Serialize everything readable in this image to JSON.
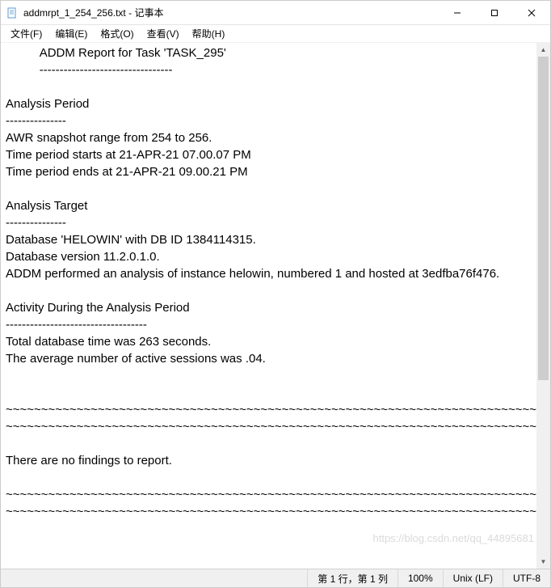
{
  "window": {
    "filename": "addmrpt_1_254_256.txt",
    "app_name": "记事本"
  },
  "menu": {
    "file": "文件(F)",
    "edit": "编辑(E)",
    "format": "格式(O)",
    "view": "查看(V)",
    "help": "帮助(H)"
  },
  "document": {
    "body": "          ADDM Report for Task 'TASK_295'\n          ---------------------------------\n\nAnalysis Period\n---------------\nAWR snapshot range from 254 to 256.\nTime period starts at 21-APR-21 07.00.07 PM\nTime period ends at 21-APR-21 09.00.21 PM\n\nAnalysis Target\n---------------\nDatabase 'HELOWIN' with DB ID 1384114315.\nDatabase version 11.2.0.1.0.\nADDM performed an analysis of instance helowin, numbered 1 and hosted at 3edfba76f476.\n\nActivity During the Analysis Period\n-----------------------------------\nTotal database time was 263 seconds.\nThe average number of active sessions was .04.\n\n\n~~~~~~~~~~~~~~~~~~~~~~~~~~~~~~~~~~~~~~~~~~~~~~~~~~~~~~~~~~~~~~~~~~~~~~~~~~~~~~\n~~~~~~~~~~~~~~~~~~~~~~~~~~~~~~~~~~~~~~~~~~~~~~~~~~~~~~~~~~~~~~~~~~~~~~~~~~~~~~\n\nThere are no findings to report.\n\n~~~~~~~~~~~~~~~~~~~~~~~~~~~~~~~~~~~~~~~~~~~~~~~~~~~~~~~~~~~~~~~~~~~~~~~~~~~~~~\n~~~~~~~~~~~~~~~~~~~~~~~~~~~~~~~~~~~~~~~~~~~~~~~~~~~~~~~~~~~~~~~~~~~~~~~~~~~~~~"
  },
  "status": {
    "position": "第 1 行，第 1 列",
    "zoom": "100%",
    "line_ending": "Unix (LF)",
    "encoding": "UTF-8"
  },
  "watermark": "https://blog.csdn.net/qq_44895681"
}
